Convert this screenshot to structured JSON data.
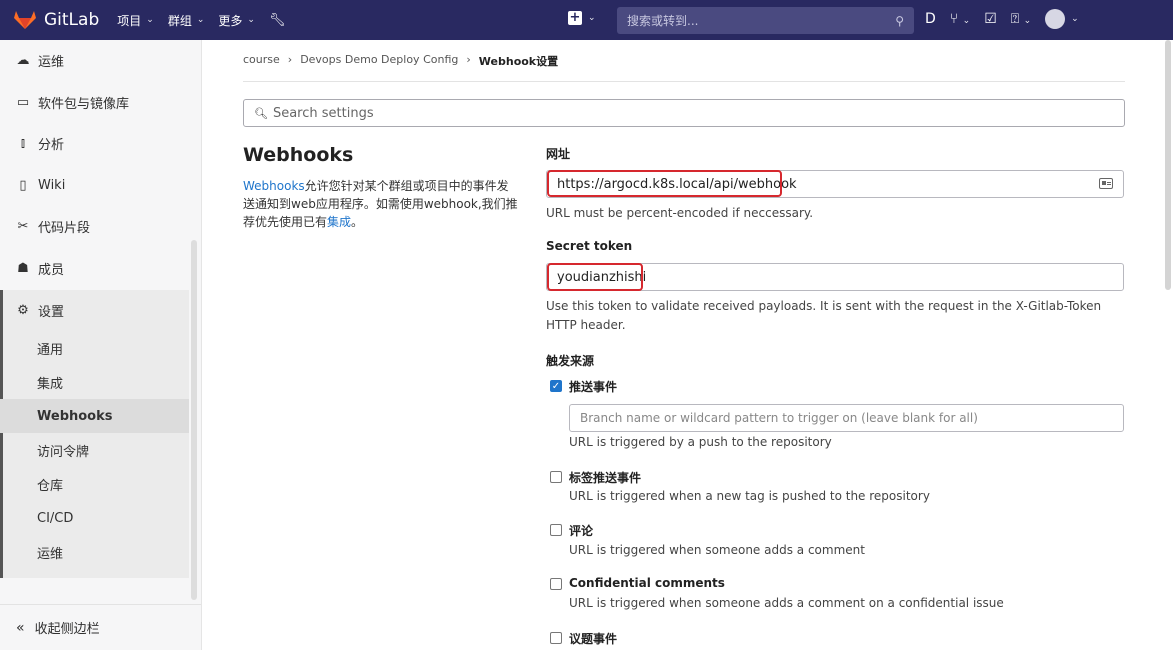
{
  "topnav": {
    "brand": "GitLab",
    "menus": [
      {
        "label": "项目"
      },
      {
        "label": "群组"
      },
      {
        "label": "更多"
      }
    ],
    "search_placeholder": "搜索或转到..."
  },
  "sidebar": {
    "items": [
      {
        "label": "运维",
        "icon": "deploy-icon"
      },
      {
        "label": "软件包与镜像库",
        "icon": "package-icon"
      },
      {
        "label": "分析",
        "icon": "chart-icon"
      },
      {
        "label": "Wiki",
        "icon": "book-icon"
      },
      {
        "label": "代码片段",
        "icon": "snippet-icon"
      },
      {
        "label": "成员",
        "icon": "members-icon"
      },
      {
        "label": "设置",
        "icon": "gear-icon"
      }
    ],
    "settings_sub": [
      {
        "label": "通用"
      },
      {
        "label": "集成"
      },
      {
        "label": "Webhooks"
      },
      {
        "label": "访问令牌"
      },
      {
        "label": "仓库"
      },
      {
        "label": "CI/CD"
      },
      {
        "label": "运维"
      }
    ],
    "active_sub": "Webhooks",
    "collapse_label": "收起侧边栏"
  },
  "breadcrumb": {
    "items": [
      "course",
      "Devops Demo Deploy Config",
      "Webhook设置"
    ],
    "separator": "›"
  },
  "search_settings": {
    "placeholder": "Search settings"
  },
  "section": {
    "title": "Webhooks",
    "desc_link1": "Webhooks",
    "desc_text": "允许您针对某个群组或项目中的事件发送通知到web应用程序。如需使用webhook,我们推荐优先使用已有",
    "desc_link2": "集成",
    "desc_end": "。"
  },
  "form": {
    "url_label": "网址",
    "url_value": "https://argocd.k8s.local/api/webhook",
    "url_help": "URL must be percent-encoded if neccessary.",
    "token_label": "Secret token",
    "token_value": "youdianzhishi",
    "token_help": "Use this token to validate received payloads. It is sent with the request in the X-Gitlab-Token HTTP header.",
    "trigger_label": "触发来源",
    "branch_placeholder": "Branch name or wildcard pattern to trigger on (leave blank for all)",
    "triggers": [
      {
        "label": "推送事件",
        "checked": true,
        "help": "URL is triggered by a push to the repository"
      },
      {
        "label": "标签推送事件",
        "checked": false,
        "help": "URL is triggered when a new tag is pushed to the repository"
      },
      {
        "label": "评论",
        "checked": false,
        "help": "URL is triggered when someone adds a comment"
      },
      {
        "label": "Confidential comments",
        "checked": false,
        "help": "URL is triggered when someone adds a comment on a confidential issue"
      },
      {
        "label": "议题事件",
        "checked": false,
        "help": ""
      }
    ]
  },
  "colors": {
    "nav_bg": "#292961",
    "link": "#1f75cb",
    "highlight": "#d6282e"
  }
}
